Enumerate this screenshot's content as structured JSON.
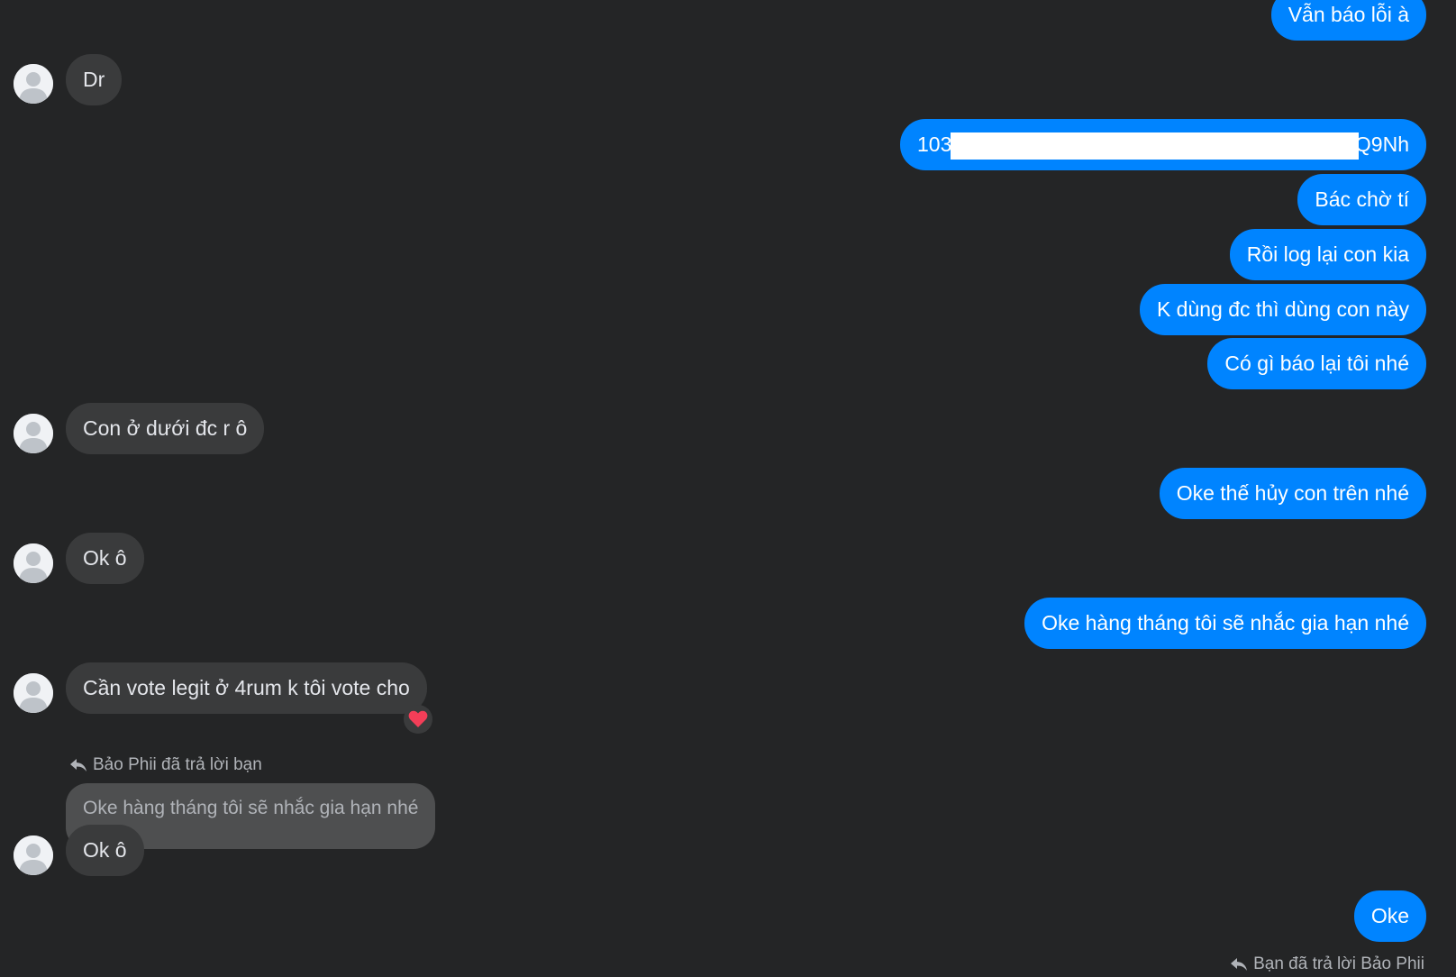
{
  "conversation": {
    "messages": [
      {
        "id": "m1",
        "side": "outgoing",
        "text": "Vẫn báo lỗi à"
      },
      {
        "id": "m2",
        "side": "incoming",
        "text": "Dr"
      },
      {
        "id": "m3",
        "side": "outgoing",
        "text_start": "103",
        "text_end": "Q9Nh",
        "redacted": true
      },
      {
        "id": "m4",
        "side": "outgoing",
        "text": "Bác chờ tí"
      },
      {
        "id": "m5",
        "side": "outgoing",
        "text": "Rồi log lại con kia"
      },
      {
        "id": "m6",
        "side": "outgoing",
        "text": "K dùng đc thì dùng con này"
      },
      {
        "id": "m7",
        "side": "outgoing",
        "text": "Có gì báo lại tôi nhé"
      },
      {
        "id": "m8",
        "side": "incoming",
        "text": "Con ở dưới đc r ô"
      },
      {
        "id": "m9",
        "side": "outgoing",
        "text": "Oke thế hủy con trên nhé"
      },
      {
        "id": "m10",
        "side": "incoming",
        "text": "Ok ô"
      },
      {
        "id": "m11",
        "side": "outgoing",
        "text": "Oke hàng tháng tôi sẽ nhắc gia hạn nhé"
      },
      {
        "id": "m12",
        "side": "incoming",
        "text": "Cần vote legit ở 4rum k tôi vote cho",
        "reaction": "heart-icon"
      },
      {
        "id": "m13",
        "side": "incoming",
        "reply_label": "Bảo Phii đã trả lời bạn",
        "quoted": "Oke hàng tháng tôi sẽ nhắc gia hạn nhé",
        "text": "Ok ô"
      },
      {
        "id": "m14",
        "side": "outgoing",
        "text": "Oke",
        "reply_label": "Bạn đã trả lời Bảo Phii"
      }
    ]
  },
  "colors": {
    "background": "#242526",
    "incoming_bubble": "#3a3b3c",
    "outgoing_bubble": "#0084ff",
    "quoted_bubble": "#4e4f50",
    "reaction": "#f33e58"
  },
  "icons": {
    "avatar": "default-avatar-icon",
    "reply": "reply-arrow-icon",
    "reaction": "heart-icon"
  }
}
